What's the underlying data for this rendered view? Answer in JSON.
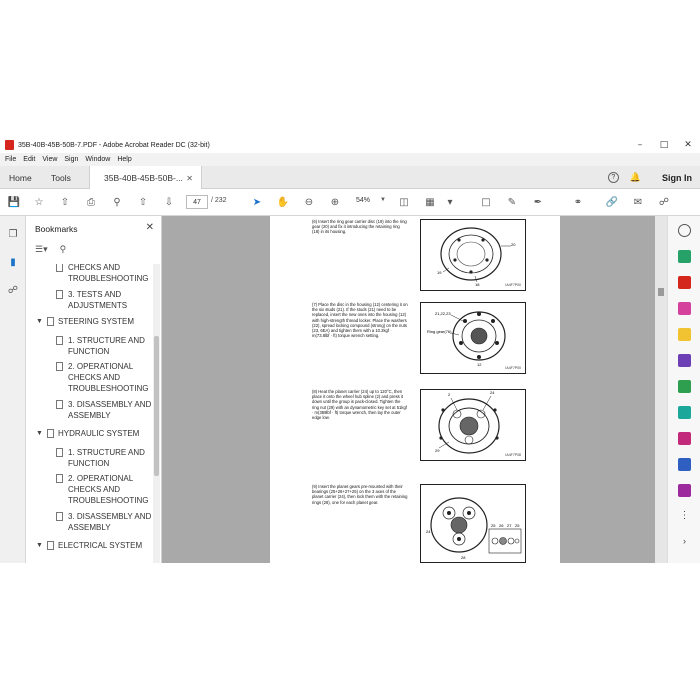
{
  "window": {
    "title": "35B-40B-45B-50B-7.PDF - Adobe Acrobat Reader DC (32-bit)",
    "controls": [
      "minimize",
      "maximize",
      "close"
    ]
  },
  "menu": [
    "File",
    "Edit",
    "View",
    "Sign",
    "Window",
    "Help"
  ],
  "tabs": {
    "home": "Home",
    "tools": "Tools",
    "document": "35B-40B-45B-50B-..."
  },
  "header_right": {
    "help_icon": "?",
    "sign_in": "Sign In"
  },
  "toolbar": {
    "current_page": "47",
    "total_pages": "/ 232",
    "zoom": "54%"
  },
  "bookmarks": {
    "title": "Bookmarks",
    "items": [
      {
        "level": 2,
        "text": "CHECKS AND TROUBLESHOOTING"
      },
      {
        "level": 2,
        "text": "3. TESTS AND ADJUSTMENTS"
      },
      {
        "level": 1,
        "text": "STEERING SYSTEM"
      },
      {
        "level": 2,
        "text": "1. STRUCTURE AND FUNCTION"
      },
      {
        "level": 2,
        "text": "2. OPERATIONAL CHECKS AND TROUBLESHOOTING"
      },
      {
        "level": 2,
        "text": "3. DISASSEMBLY AND ASSEMBLY"
      },
      {
        "level": 1,
        "text": "HYDRAULIC SYSTEM"
      },
      {
        "level": 2,
        "text": "1. STRUCTURE AND FUNCTION"
      },
      {
        "level": 2,
        "text": "2. OPERATIONAL CHECKS AND TROUBLESHOOTING"
      },
      {
        "level": 2,
        "text": "3. DISASSEMBLY AND ASSEMBLY"
      },
      {
        "level": 1,
        "text": "ELECTRICAL SYSTEM"
      }
    ]
  },
  "document": {
    "steps": [
      {
        "text": "(6) Insert the ring gear carrier disc (19) into the ring gear (20) and fix it introducing the retaining ring (18) in its housing.",
        "fig_labels": [
          "20",
          "19",
          "18"
        ],
        "fig_code": "IA4F7P00"
      },
      {
        "text": "(7) Place the disc in the housing (12) centering it on the six studs (21). If the studs (21) need to be replaced, insert the new ones into the housing (12) with high-strength thread locker. Place the washers (22), spread locking compound (strong) on the nuts (23, 6EA) and tighten them with a 10.2kgf · m(73.8lbf · ft) torque wrench setting.",
        "fig_labels": [
          "21,22,23",
          "Ring gear(76)",
          "12"
        ],
        "fig_code": "IA4F7P00"
      },
      {
        "text": "(8) Heat the planet carrier (24) up to 120°C, then place it onto the wheel hub spline (2) and press it down until the group is pack-closed. Tighten the ring nut (29) with an dynamometric key set at 51kgf · m(369lbf · ft) torque wrench, then lay the outer edge low.",
        "fig_labels": [
          "2",
          "24",
          "29"
        ],
        "fig_code": "IA4F7P08"
      },
      {
        "text": "(9) Insert the planet gears pre-mounted with their bearings (25+26+27+25) on the 3 axes of the planet carrier (24), then lock them with the retaining rings (28), one for each planet gear.",
        "fig_labels": [
          "24",
          "28",
          "25",
          "26",
          "27",
          "25"
        ],
        "fig_code": "IA4F7P11"
      }
    ]
  },
  "colors": {
    "accent": "#1a73c9",
    "doc_bg": "#a9a9a9",
    "pdf_icon": "#d4261c"
  },
  "icons": {
    "left_nav": [
      "pages-icon",
      "bookmark-icon",
      "attachment-icon"
    ],
    "right_tools": [
      "zoom-icon",
      "export-pdf-icon",
      "create-pdf-icon",
      "edit-pdf-icon",
      "comment-icon",
      "combine-icon",
      "organize-icon",
      "fill-sign-icon",
      "protect-icon",
      "send-icon",
      "more-tools-icon"
    ]
  }
}
